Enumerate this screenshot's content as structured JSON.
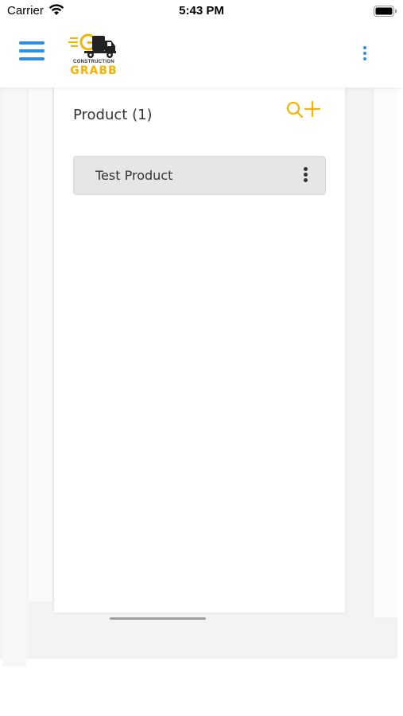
{
  "status_bar": {
    "carrier": "Carrier",
    "time": "5:43 PM"
  },
  "header": {
    "menu_icon": "hamburger-icon",
    "logo": {
      "small_text": "CONSTRUCTION",
      "big_text": "GRABB"
    },
    "overflow_icon": "vertical-dots-icon"
  },
  "products": {
    "title": "Product (1)",
    "search_icon": "search-icon",
    "add_icon": "plus-icon",
    "items": [
      {
        "label": "Test Product",
        "menu_icon": "vertical-dots-icon"
      }
    ]
  },
  "colors": {
    "accent_blue": "#2f8fe0",
    "brand_yellow": "#f4b400",
    "item_bg": "#e6e6e6"
  }
}
